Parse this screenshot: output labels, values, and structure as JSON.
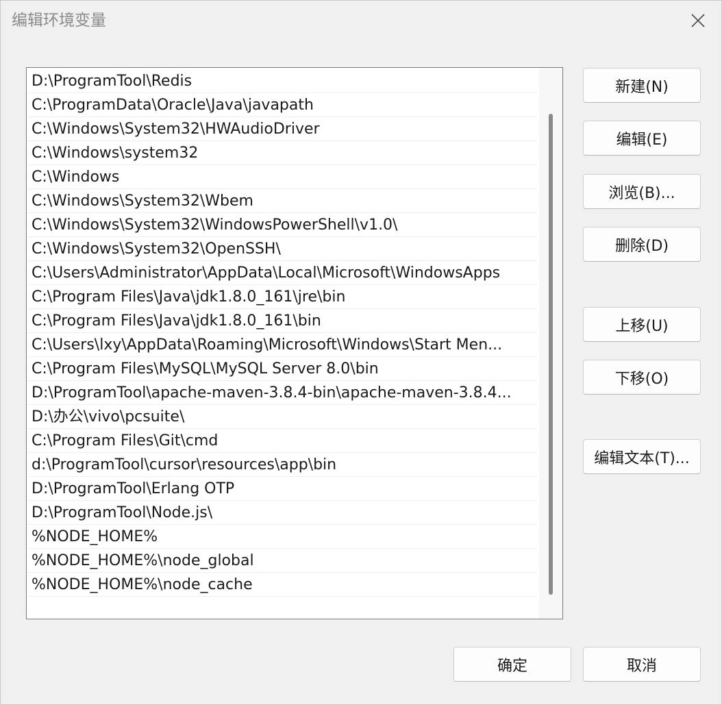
{
  "window": {
    "title": "编辑环境变量",
    "close_icon": "close-icon"
  },
  "path_list": {
    "items": [
      "D:\\ProgramTool\\Redis",
      "C:\\ProgramData\\Oracle\\Java\\javapath",
      "C:\\Windows\\System32\\HWAudioDriver",
      "C:\\Windows\\system32",
      "C:\\Windows",
      "C:\\Windows\\System32\\Wbem",
      "C:\\Windows\\System32\\WindowsPowerShell\\v1.0\\",
      "C:\\Windows\\System32\\OpenSSH\\",
      "C:\\Users\\Administrator\\AppData\\Local\\Microsoft\\WindowsApps",
      "C:\\Program Files\\Java\\jdk1.8.0_161\\jre\\bin",
      "C:\\Program Files\\Java\\jdk1.8.0_161\\bin",
      "C:\\Users\\lxy\\AppData\\Roaming\\Microsoft\\Windows\\Start Men...",
      "C:\\Program Files\\MySQL\\MySQL Server 8.0\\bin",
      "D:\\ProgramTool\\apache-maven-3.8.4-bin\\apache-maven-3.8.4...",
      "D:\\办公\\vivo\\pcsuite\\",
      "C:\\Program Files\\Git\\cmd",
      "d:\\ProgramTool\\cursor\\resources\\app\\bin",
      "D:\\ProgramTool\\Erlang OTP",
      "D:\\ProgramTool\\Node.js\\",
      "%NODE_HOME%",
      "%NODE_HOME%\\node_global",
      "%NODE_HOME%\\node_cache"
    ]
  },
  "buttons": {
    "new": "新建(N)",
    "edit": "编辑(E)",
    "browse": "浏览(B)...",
    "delete": "删除(D)",
    "move_up": "上移(U)",
    "move_down": "下移(O)",
    "edit_text": "编辑文本(T)...",
    "ok": "确定",
    "cancel": "取消"
  }
}
